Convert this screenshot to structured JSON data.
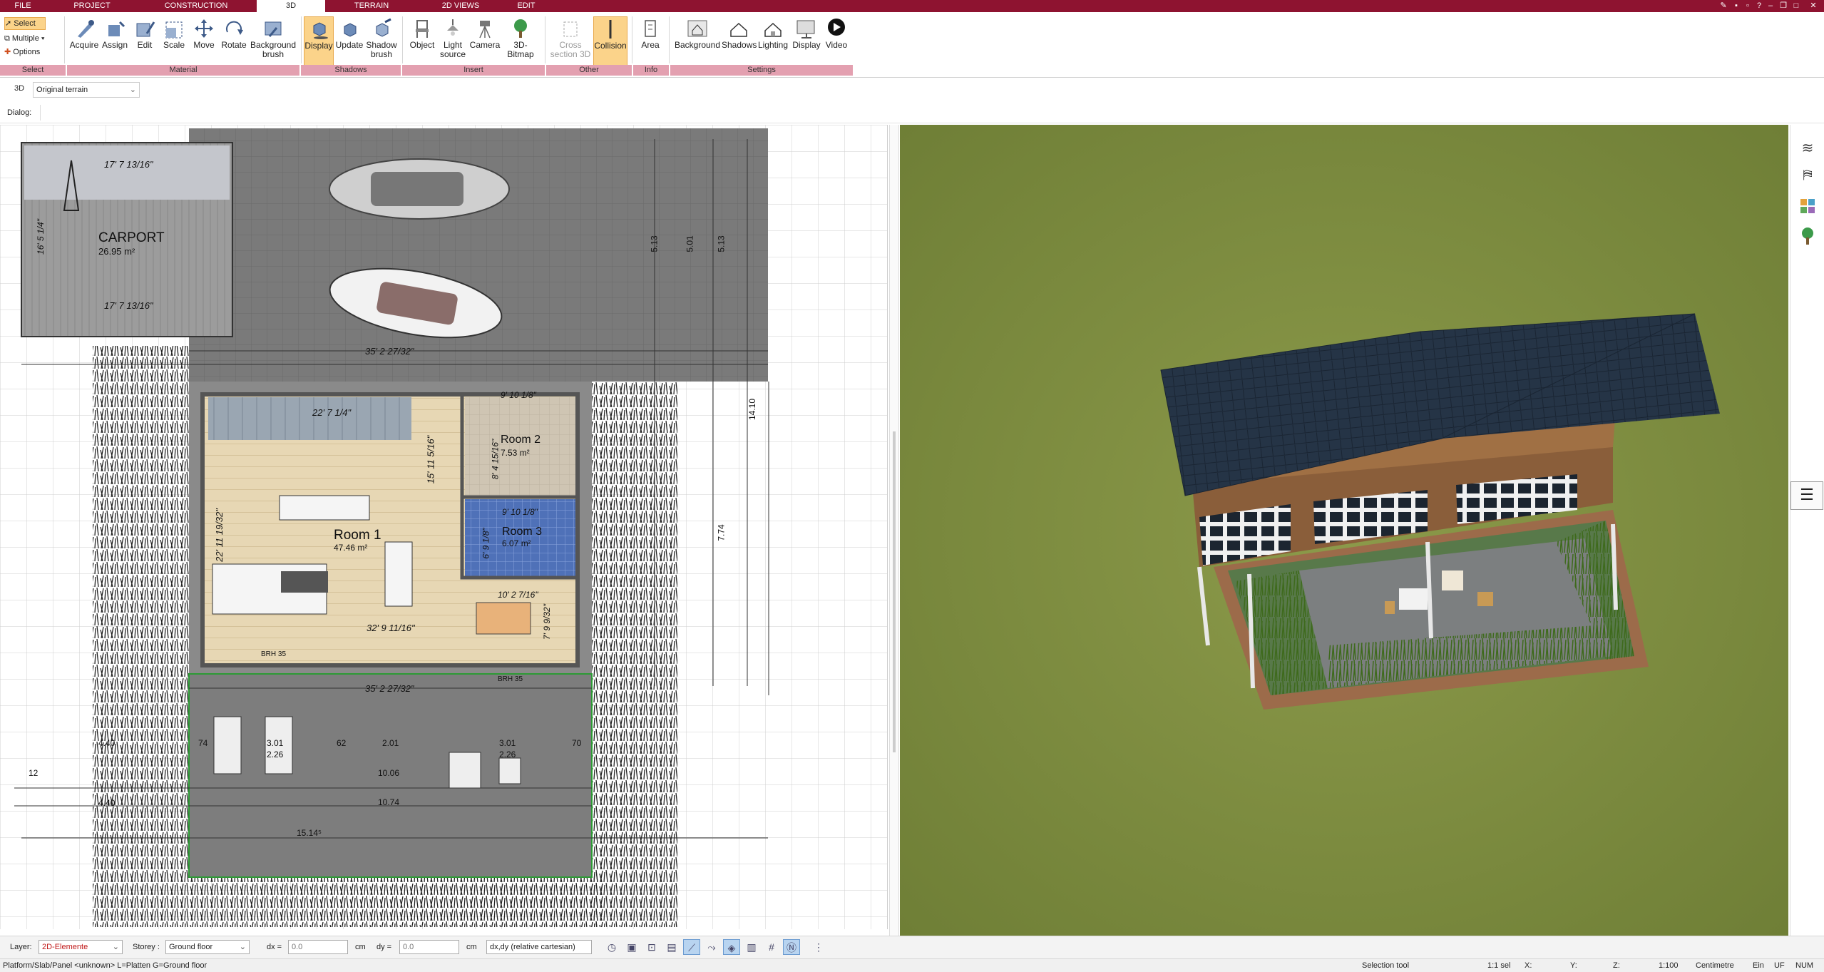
{
  "tabs": [
    "FILE",
    "PROJECT",
    "CONSTRUCTION",
    "3D",
    "TERRAIN",
    "2D VIEWS",
    "EDIT"
  ],
  "select": {
    "select_label": "Select",
    "multiple_label": "Multiple",
    "options_label": "Options"
  },
  "ribbon": {
    "buttons": [
      "Acquire",
      "Assign",
      "Edit",
      "Scale",
      "Move",
      "Rotate",
      "Background brush",
      "Display",
      "Update",
      "Shadow brush",
      "Object",
      "Light source",
      "Camera",
      "3D-Bitmap",
      "Cross section 3D",
      "Collision",
      "Area",
      "Background",
      "Shadows",
      "Lighting",
      "Display",
      "Video"
    ],
    "groups": [
      "Select",
      "Material",
      "Shadows",
      "Insert",
      "Other",
      "Info",
      "Settings"
    ]
  },
  "view_row": {
    "mode": "3D",
    "terrain": "Original terrain"
  },
  "dialog_label": "Dialog:",
  "plan": {
    "carport_title": "CARPORT",
    "carport_area": "26.95 m²",
    "carport_dim_top": "17' 7 13/16\"",
    "carport_dim_bottom": "17' 7 13/16\"",
    "carport_dim_side": "16' 5 1/4\"",
    "room1_title": "Room 1",
    "room1_area": "47.46 m²",
    "room2_title": "Room 2",
    "room2_area": "7.53 m²",
    "room3_title": "Room 3",
    "room3_area": "6.07 m²",
    "dim_35_top": "35' 2 27/32\"",
    "dim_35_mid": "35' 2 27/32\"",
    "dim_32": "32' 9 11/16\"",
    "dim_22_7": "22' 7 1/4\"",
    "dim_15_11": "15' 11 5/16\"",
    "dim_22_11": "22' 11 19/32\"",
    "dim_9_10": "9' 10 1/8\"",
    "dim_9_10b": "9' 10 1/8\"",
    "dim_10_2": "10' 2 7/16\"",
    "dim_7_9": "7' 9 9/32\"",
    "dim_8_4": "8' 4 15/16\"",
    "dim_6_9": "6' 9 1/8\"",
    "v_513": "5.13",
    "v_501": "5.01",
    "v_513b": "5.13",
    "v_774": "7.74",
    "v_1410": "14.10",
    "terrace_1074": "10.74",
    "terrace_1006": "10.06",
    "terrace_1514": "15.14⁵",
    "terrace_301": "3.01",
    "terrace_226": "2.26",
    "terrace_201": "2.01",
    "terrace_62": "62",
    "terrace_74": "74",
    "terrace_70": "70",
    "terrace_440": "4.40",
    "terrace_12": "12",
    "brh": "BRH 35"
  },
  "bottom": {
    "layer_label": "Layer:",
    "layer_value": "2D-Elemente",
    "storey_label": "Storey :",
    "storey_value": "Ground floor",
    "dx_label": "dx =",
    "dx_value": "0.0",
    "dy_label": "dy =",
    "dy_value": "0.0",
    "unit": "cm",
    "coord_mode": "dx,dy (relative cartesian)"
  },
  "status": {
    "left": "Platform/Slab/Panel <unknown> L=Platten G=Ground floor",
    "tool": "Selection tool",
    "scale_sel": "1:1 sel",
    "x": "X:",
    "y": "Y:",
    "z": "Z:",
    "scale": "1:100",
    "unit": "Centimetre",
    "ein": "Ein",
    "uf": "UF",
    "num": "NUM"
  }
}
